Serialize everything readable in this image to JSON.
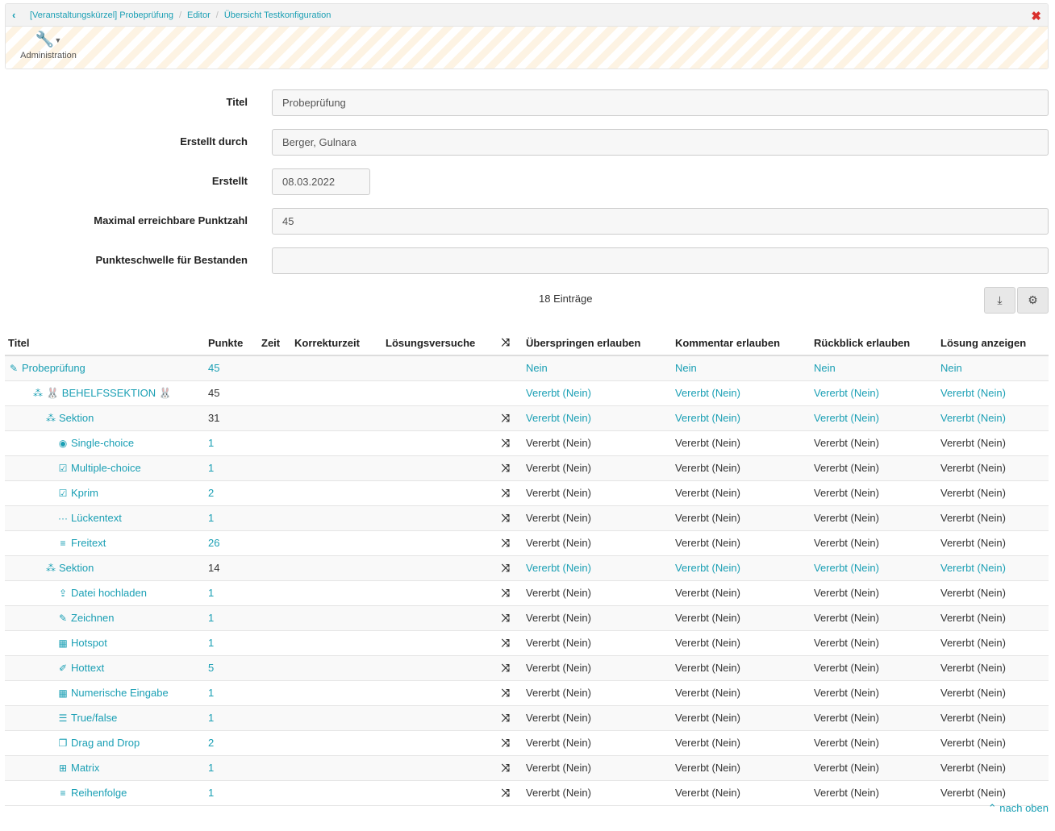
{
  "breadcrumb": {
    "back_icon": "chevron-left-icon",
    "items": [
      "[Veranstaltungskürzel] Probeprüfung",
      "Editor",
      "Übersicht Testkonfiguration"
    ],
    "close_icon": "close-icon"
  },
  "admin": {
    "label": "Administration",
    "icon": "wrench-icon"
  },
  "form": {
    "titel_label": "Titel",
    "titel_value": "Probeprüfung",
    "erstellt_durch_label": "Erstellt durch",
    "erstellt_durch_value": "Berger, Gulnara",
    "erstellt_label": "Erstellt",
    "erstellt_value": "08.03.2022",
    "max_label": "Maximal erreichbare Punktzahl",
    "max_value": "45",
    "schwelle_label": "Punkteschwelle für Bestanden",
    "schwelle_value": ""
  },
  "table": {
    "entries": "18 Einträge",
    "columns": [
      "Titel",
      "Punkte",
      "Zeit",
      "Korrekturzeit",
      "Lösungsversuche",
      "",
      "Überspringen erlauben",
      "Kommentar erlauben",
      "Rückblick erlauben",
      "Lösung anzeigen"
    ],
    "rows": [
      {
        "title": "Probeprüfung",
        "icon": "test-icon",
        "glyph": "✎",
        "indent": 0,
        "title_link": true,
        "points": "45",
        "points_link": true,
        "shuffle": false,
        "values": [
          "Nein",
          "Nein",
          "Nein",
          "Nein"
        ],
        "values_link": true
      },
      {
        "title": "🐰 BEHELFSSEKTION 🐰",
        "icon": "section-icon",
        "glyph": "⁂",
        "indent": 1,
        "title_link": true,
        "points": "45",
        "points_link": false,
        "shuffle": false,
        "values": [
          "Vererbt (Nein)",
          "Vererbt (Nein)",
          "Vererbt (Nein)",
          "Vererbt (Nein)"
        ],
        "values_link": true
      },
      {
        "title": "Sektion",
        "icon": "section-icon",
        "glyph": "⁂",
        "indent": 2,
        "title_link": true,
        "points": "31",
        "points_link": false,
        "shuffle": true,
        "values": [
          "Vererbt (Nein)",
          "Vererbt (Nein)",
          "Vererbt (Nein)",
          "Vererbt (Nein)"
        ],
        "values_link": true
      },
      {
        "title": "Single-choice",
        "icon": "radio-icon",
        "glyph": "◉",
        "indent": 3,
        "title_link": true,
        "points": "1",
        "points_link": true,
        "shuffle": true,
        "values": [
          "Vererbt (Nein)",
          "Vererbt (Nein)",
          "Vererbt (Nein)",
          "Vererbt (Nein)"
        ],
        "values_link": false
      },
      {
        "title": "Multiple-choice",
        "icon": "checkbox-icon",
        "glyph": "☑",
        "indent": 3,
        "title_link": true,
        "points": "1",
        "points_link": true,
        "shuffle": true,
        "values": [
          "Vererbt (Nein)",
          "Vererbt (Nein)",
          "Vererbt (Nein)",
          "Vererbt (Nein)"
        ],
        "values_link": false
      },
      {
        "title": "Kprim",
        "icon": "checked-square-icon",
        "glyph": "☑",
        "indent": 3,
        "title_link": true,
        "points": "2",
        "points_link": true,
        "shuffle": true,
        "values": [
          "Vererbt (Nein)",
          "Vererbt (Nein)",
          "Vererbt (Nein)",
          "Vererbt (Nein)"
        ],
        "values_link": false
      },
      {
        "title": "Lückentext",
        "icon": "ellipsis-icon",
        "glyph": "···",
        "indent": 3,
        "title_link": true,
        "points": "1",
        "points_link": true,
        "shuffle": true,
        "values": [
          "Vererbt (Nein)",
          "Vererbt (Nein)",
          "Vererbt (Nein)",
          "Vererbt (Nein)"
        ],
        "values_link": false
      },
      {
        "title": "Freitext",
        "icon": "lines-icon",
        "glyph": "≡",
        "indent": 3,
        "title_link": true,
        "points": "26",
        "points_link": true,
        "shuffle": true,
        "values": [
          "Vererbt (Nein)",
          "Vererbt (Nein)",
          "Vererbt (Nein)",
          "Vererbt (Nein)"
        ],
        "values_link": false
      },
      {
        "title": "Sektion",
        "icon": "section-icon",
        "glyph": "⁂",
        "indent": 2,
        "title_link": true,
        "points": "14",
        "points_link": false,
        "shuffle": true,
        "values": [
          "Vererbt (Nein)",
          "Vererbt (Nein)",
          "Vererbt (Nein)",
          "Vererbt (Nein)"
        ],
        "values_link": true
      },
      {
        "title": "Datei hochladen",
        "icon": "upload-icon",
        "glyph": "⇪",
        "indent": 3,
        "title_link": true,
        "points": "1",
        "points_link": true,
        "shuffle": true,
        "values": [
          "Vererbt (Nein)",
          "Vererbt (Nein)",
          "Vererbt (Nein)",
          "Vererbt (Nein)"
        ],
        "values_link": false
      },
      {
        "title": "Zeichnen",
        "icon": "brush-icon",
        "glyph": "✎",
        "indent": 3,
        "title_link": true,
        "points": "1",
        "points_link": true,
        "shuffle": true,
        "values": [
          "Vererbt (Nein)",
          "Vererbt (Nein)",
          "Vererbt (Nein)",
          "Vererbt (Nein)"
        ],
        "values_link": false
      },
      {
        "title": "Hotspot",
        "icon": "map-icon",
        "glyph": "▦",
        "indent": 3,
        "title_link": true,
        "points": "1",
        "points_link": true,
        "shuffle": true,
        "values": [
          "Vererbt (Nein)",
          "Vererbt (Nein)",
          "Vererbt (Nein)",
          "Vererbt (Nein)"
        ],
        "values_link": false
      },
      {
        "title": "Hottext",
        "icon": "marker-icon",
        "glyph": "✐",
        "indent": 3,
        "title_link": true,
        "points": "5",
        "points_link": true,
        "shuffle": true,
        "values": [
          "Vererbt (Nein)",
          "Vererbt (Nein)",
          "Vererbt (Nein)",
          "Vererbt (Nein)"
        ],
        "values_link": false
      },
      {
        "title": "Numerische Eingabe",
        "icon": "calculator-icon",
        "glyph": "▦",
        "indent": 3,
        "title_link": true,
        "points": "1",
        "points_link": true,
        "shuffle": true,
        "values": [
          "Vererbt (Nein)",
          "Vererbt (Nein)",
          "Vererbt (Nein)",
          "Vererbt (Nein)"
        ],
        "values_link": false
      },
      {
        "title": "True/false",
        "icon": "list-icon",
        "glyph": "☰",
        "indent": 3,
        "title_link": true,
        "points": "1",
        "points_link": true,
        "shuffle": true,
        "values": [
          "Vererbt (Nein)",
          "Vererbt (Nein)",
          "Vererbt (Nein)",
          "Vererbt (Nein)"
        ],
        "values_link": false
      },
      {
        "title": "Drag and Drop",
        "icon": "copy-icon",
        "glyph": "❐",
        "indent": 3,
        "title_link": true,
        "points": "2",
        "points_link": true,
        "shuffle": true,
        "values": [
          "Vererbt (Nein)",
          "Vererbt (Nein)",
          "Vererbt (Nein)",
          "Vererbt (Nein)"
        ],
        "values_link": false
      },
      {
        "title": "Matrix",
        "icon": "table-icon",
        "glyph": "⊞",
        "indent": 3,
        "title_link": true,
        "points": "1",
        "points_link": true,
        "shuffle": true,
        "values": [
          "Vererbt (Nein)",
          "Vererbt (Nein)",
          "Vererbt (Nein)",
          "Vererbt (Nein)"
        ],
        "values_link": false
      },
      {
        "title": "Reihenfolge",
        "icon": "order-icon",
        "glyph": "≡",
        "indent": 3,
        "title_link": true,
        "points": "1",
        "points_link": true,
        "shuffle": true,
        "values": [
          "Vererbt (Nein)",
          "Vererbt (Nein)",
          "Vererbt (Nein)",
          "Vererbt (Nein)"
        ],
        "values_link": false
      }
    ]
  },
  "footer": {
    "back_to_top": "nach oben",
    "back_to_top_icon": "chevron-up-icon"
  },
  "colors": {
    "link": "#1a9fb4",
    "close": "#d9302c",
    "stripe": "#fdf3e3"
  }
}
